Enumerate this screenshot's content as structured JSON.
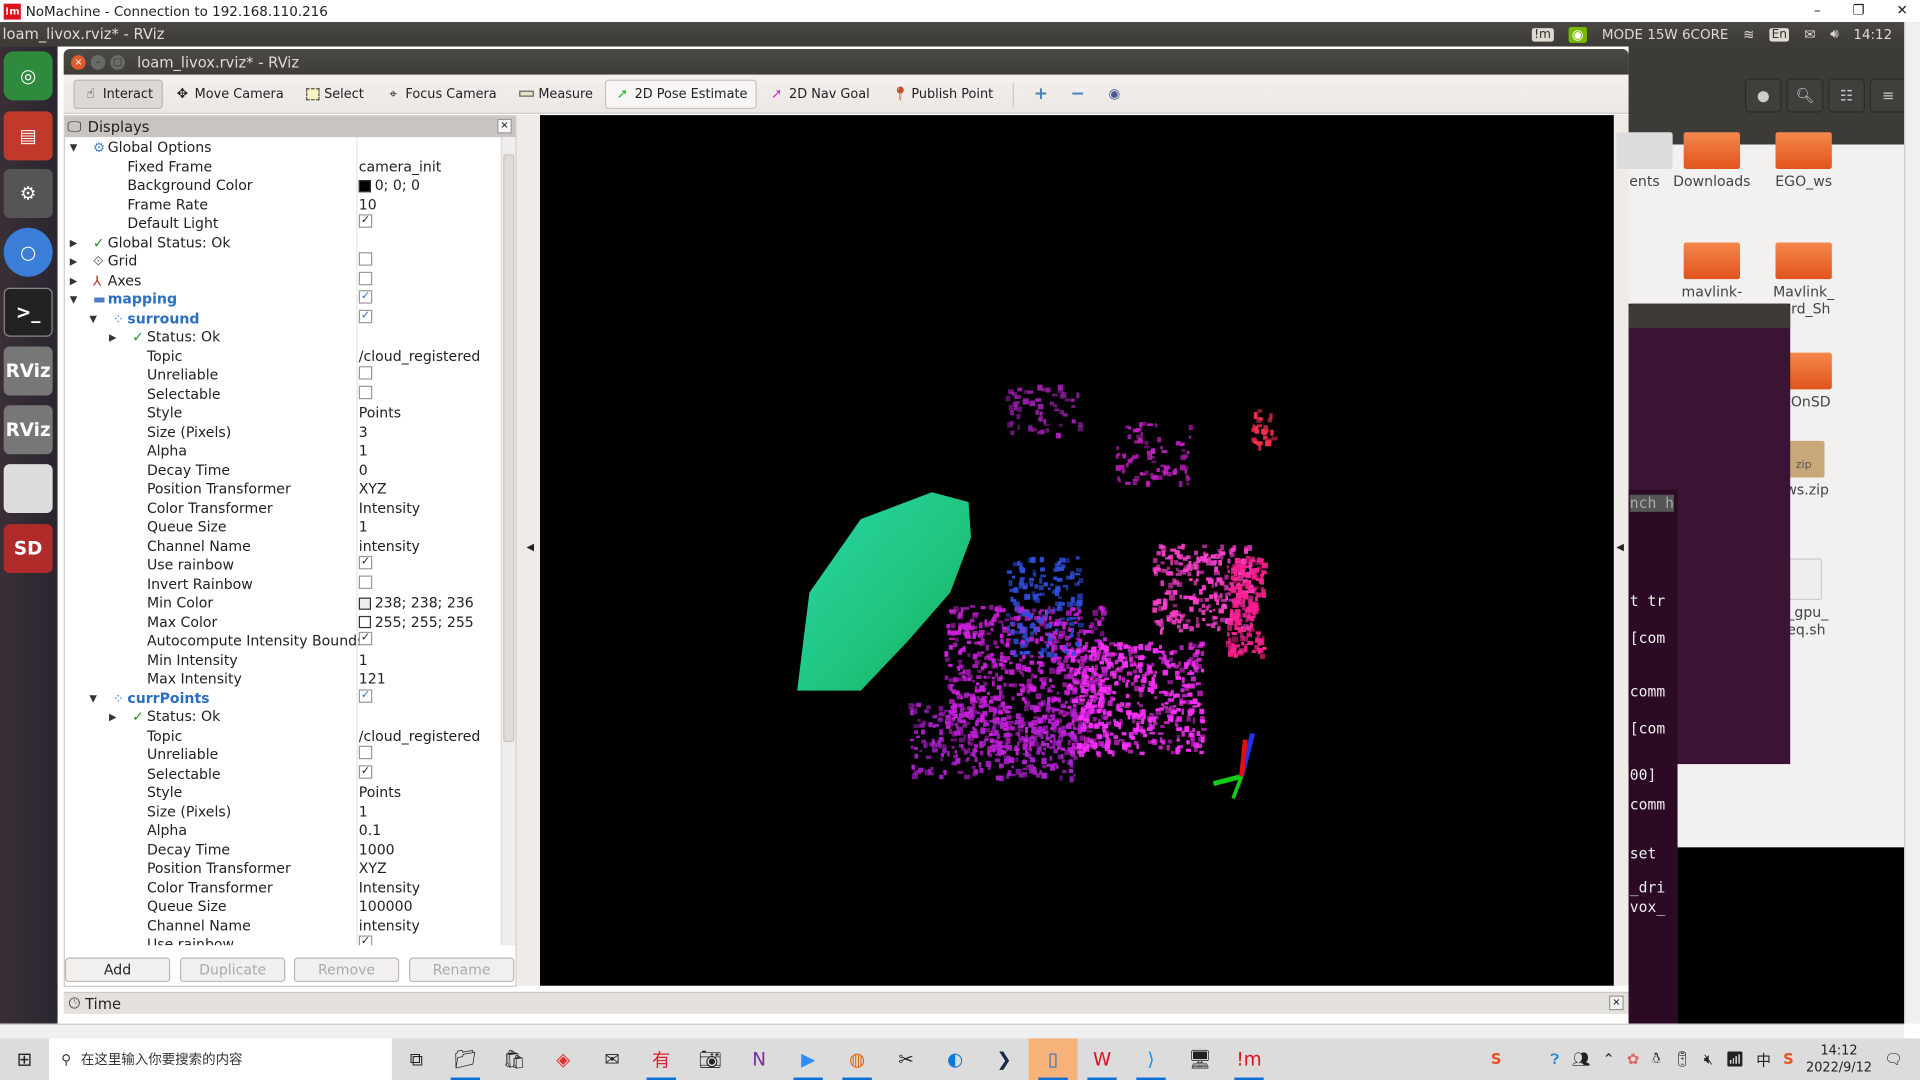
{
  "nomachine": {
    "title": "NoMachine - Connection to 192.168.110.216",
    "logo_text": "!m"
  },
  "top_panel": {
    "app_title": "loam_livox.rviz* - RViz",
    "power_mode": "MODE 15W 6CORE",
    "keyboard": "En",
    "time": "14:12",
    "icons": [
      "nomachine-icon",
      "nvidia-icon",
      "wifi-icon",
      "mail-icon",
      "volume-icon",
      "power-icon"
    ]
  },
  "launcher": {
    "items": [
      "ubuntu-dash",
      "files",
      "system-settings",
      "chromium",
      "terminal",
      "rviz",
      "rviz",
      "disk",
      "sd-card"
    ],
    "rviz_label": "RViz",
    "sd_label": "SD"
  },
  "rviz": {
    "window_title": "loam_livox.rviz* - RViz",
    "toolbar": [
      {
        "label": "Interact",
        "icon": "hand-icon",
        "state": "active"
      },
      {
        "label": "Move Camera",
        "icon": "move-camera-icon"
      },
      {
        "label": "Select",
        "icon": "select-icon"
      },
      {
        "label": "Focus Camera",
        "icon": "focus-camera-icon"
      },
      {
        "label": "Measure",
        "icon": "ruler-icon"
      },
      {
        "label": "2D Pose Estimate",
        "icon": "green-arrow-icon",
        "state": "boxed"
      },
      {
        "label": "2D Nav Goal",
        "icon": "magenta-arrow-icon"
      },
      {
        "label": "Publish Point",
        "icon": "map-pin-icon"
      }
    ],
    "displays": {
      "title": "Displays",
      "rows": [
        {
          "depth": 0,
          "label": "Global Options",
          "icon": "gear-icon",
          "expand": "open"
        },
        {
          "depth": 1,
          "label": "Fixed Frame",
          "value": "camera_init"
        },
        {
          "depth": 1,
          "label": "Background Color",
          "value": "0; 0; 0",
          "color": "#000000"
        },
        {
          "depth": 1,
          "label": "Frame Rate",
          "value": "10"
        },
        {
          "depth": 1,
          "label": "Default Light",
          "check": true
        },
        {
          "depth": 0,
          "label": "Global Status: Ok",
          "icon": "check-icon",
          "expand": "closed"
        },
        {
          "depth": 0,
          "label": "Grid",
          "icon": "grid-icon",
          "expand": "closed",
          "check": false
        },
        {
          "depth": 0,
          "label": "Axes",
          "icon": "axes-icon",
          "expand": "closed",
          "check": false
        },
        {
          "depth": 0,
          "label": "mapping",
          "icon": "folder-icon",
          "expand": "open",
          "check": true,
          "bold": true
        },
        {
          "depth": 1,
          "label": "surround",
          "icon": "pointcloud-icon",
          "expand": "open",
          "check": true,
          "bold": true
        },
        {
          "depth": 2,
          "label": "Status: Ok",
          "icon": "check-icon",
          "expand": "closed"
        },
        {
          "depth": 2,
          "label": "Topic",
          "value": "/cloud_registered"
        },
        {
          "depth": 2,
          "label": "Unreliable",
          "check": false
        },
        {
          "depth": 2,
          "label": "Selectable",
          "check": false
        },
        {
          "depth": 2,
          "label": "Style",
          "value": "Points"
        },
        {
          "depth": 2,
          "label": "Size (Pixels)",
          "value": "3"
        },
        {
          "depth": 2,
          "label": "Alpha",
          "value": "1"
        },
        {
          "depth": 2,
          "label": "Decay Time",
          "value": "0"
        },
        {
          "depth": 2,
          "label": "Position Transformer",
          "value": "XYZ"
        },
        {
          "depth": 2,
          "label": "Color Transformer",
          "value": "Intensity"
        },
        {
          "depth": 2,
          "label": "Queue Size",
          "value": "1"
        },
        {
          "depth": 2,
          "label": "Channel Name",
          "value": "intensity"
        },
        {
          "depth": 2,
          "label": "Use rainbow",
          "check": true
        },
        {
          "depth": 2,
          "label": "Invert Rainbow",
          "check": false
        },
        {
          "depth": 2,
          "label": "Min Color",
          "value": "238; 238; 236",
          "color": "#eeeeec"
        },
        {
          "depth": 2,
          "label": "Max Color",
          "value": "255; 255; 255",
          "color": "#ffffff"
        },
        {
          "depth": 2,
          "label": "Autocompute Intensity Bounds",
          "check": true
        },
        {
          "depth": 2,
          "label": "Min Intensity",
          "value": "1"
        },
        {
          "depth": 2,
          "label": "Max Intensity",
          "value": "121"
        },
        {
          "depth": 1,
          "label": "currPoints",
          "icon": "pointcloud-icon",
          "expand": "open",
          "check": true,
          "bold": true
        },
        {
          "depth": 2,
          "label": "Status: Ok",
          "icon": "check-icon",
          "expand": "closed"
        },
        {
          "depth": 2,
          "label": "Topic",
          "value": "/cloud_registered"
        },
        {
          "depth": 2,
          "label": "Unreliable",
          "check": false
        },
        {
          "depth": 2,
          "label": "Selectable",
          "check": true
        },
        {
          "depth": 2,
          "label": "Style",
          "value": "Points"
        },
        {
          "depth": 2,
          "label": "Size (Pixels)",
          "value": "1"
        },
        {
          "depth": 2,
          "label": "Alpha",
          "value": "0.1"
        },
        {
          "depth": 2,
          "label": "Decay Time",
          "value": "1000"
        },
        {
          "depth": 2,
          "label": "Position Transformer",
          "value": "XYZ"
        },
        {
          "depth": 2,
          "label": "Color Transformer",
          "value": "Intensity"
        },
        {
          "depth": 2,
          "label": "Queue Size",
          "value": "100000"
        },
        {
          "depth": 2,
          "label": "Channel Name",
          "value": "intensity"
        },
        {
          "depth": 2,
          "label": "Use rainbow",
          "check": true
        }
      ],
      "buttons": {
        "add": "Add",
        "duplicate": "Duplicate",
        "remove": "Remove",
        "rename": "Rename"
      }
    },
    "time_panel": {
      "title": "Time"
    }
  },
  "files": {
    "items": [
      {
        "label": "ents"
      },
      {
        "label": "Downloads"
      },
      {
        "label": "EGO_ws"
      },
      {
        "label": "mavlink-"
      },
      {
        "label": "Mavlink_\nterd_Sh"
      },
      {
        "label": "otOnSD"
      },
      {
        "label": "_ws.zip",
        "badge": "zip"
      },
      {
        "label": "x_gpu_\nreq.sh"
      }
    ]
  },
  "terminal": {
    "lines": [
      "nch h",
      "t tr",
      "[com",
      "comm",
      "[com",
      "00]",
      "comm",
      "set",
      "_dri",
      "vox_"
    ]
  },
  "taskbar": {
    "search_placeholder": "在这里输入你要搜索的内容",
    "apps": [
      "task-view",
      "file-explorer",
      "store",
      "app-red-diamond",
      "mail",
      "youdao",
      "camera",
      "onenote",
      "zoom",
      "firefox",
      "snipping",
      "edge",
      "powershell",
      "phone-link",
      "wps",
      "vscode",
      "remote-desktop",
      "nomachine"
    ],
    "youdao_label": "有道",
    "clock_time": "14:12",
    "clock_date": "2022/9/12",
    "ime": "中"
  }
}
